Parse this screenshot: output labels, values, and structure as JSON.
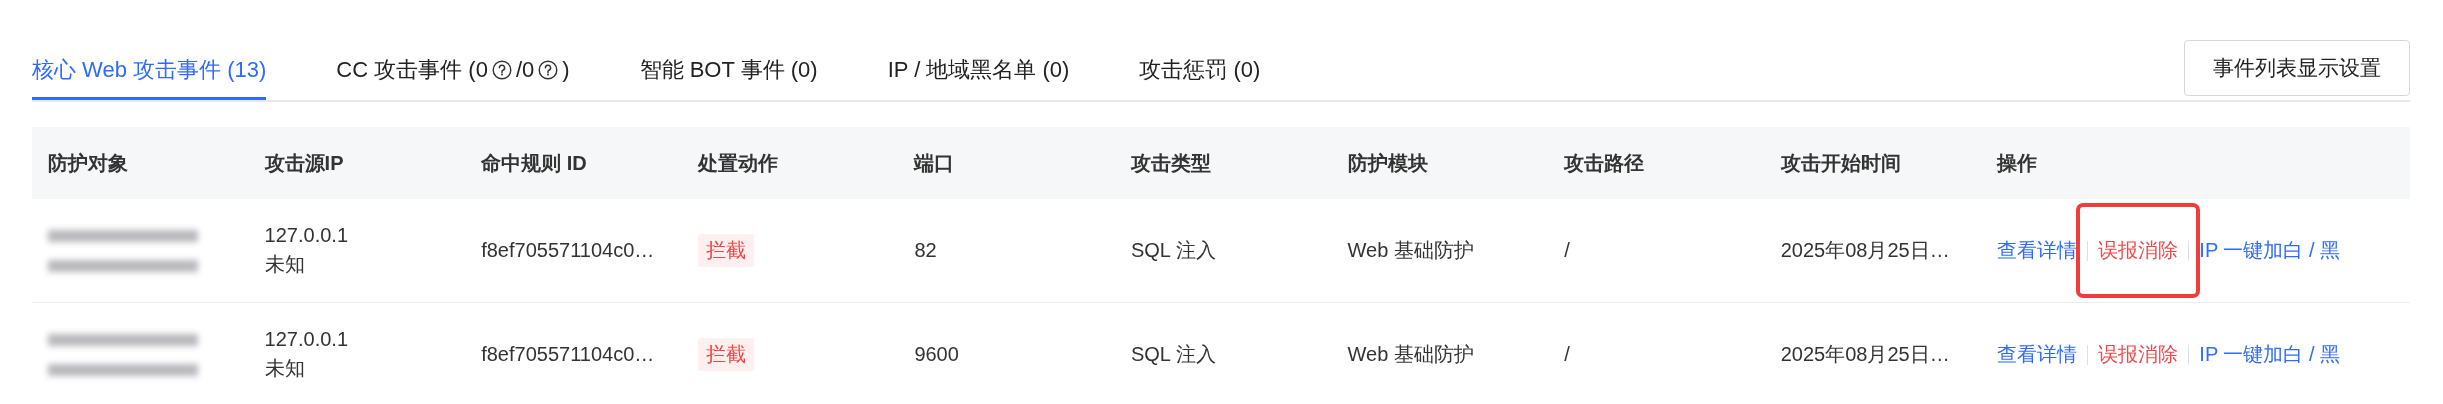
{
  "tabs": [
    {
      "selected": true,
      "segments": [
        {
          "kind": "text",
          "text": "核心 Web 攻击事件 (13)"
        }
      ]
    },
    {
      "selected": false,
      "segments": [
        {
          "kind": "text",
          "text": "CC 攻击事件 (0"
        },
        {
          "kind": "help"
        },
        {
          "kind": "text",
          "text": "/0"
        },
        {
          "kind": "help"
        },
        {
          "kind": "text",
          "text": ")"
        }
      ]
    },
    {
      "selected": false,
      "segments": [
        {
          "kind": "text",
          "text": "智能 BOT 事件 (0)"
        }
      ]
    },
    {
      "selected": false,
      "segments": [
        {
          "kind": "text",
          "text": "IP / 地域黑名单 (0)"
        }
      ]
    },
    {
      "selected": false,
      "segments": [
        {
          "kind": "text",
          "text": "攻击惩罚 (0)"
        }
      ]
    }
  ],
  "settings_button": "事件列表显示设置",
  "table": {
    "columns": [
      "防护对象",
      "攻击源IP",
      "命中规则 ID",
      "处置动作",
      "端口",
      "攻击类型",
      "防护模块",
      "攻击路径",
      "攻击开始时间",
      "操作"
    ],
    "rows": [
      {
        "target": {
          "redacted": true
        },
        "source_ip": "127.0.0.1",
        "source_location": "未知",
        "rule_id": "f8ef705571104c0…",
        "action": {
          "label": "拦截",
          "kind": "block"
        },
        "port": "82",
        "attack_type": "SQL 注入",
        "module": "Web 基础防护",
        "path": "/",
        "start_time": "2025年08月25日…",
        "operations": [
          {
            "label": "查看详情",
            "kind": "link",
            "highlighted": false
          },
          {
            "label": "误报消除",
            "kind": "danger",
            "highlighted": true
          },
          {
            "label": "IP 一键加白 / 黑",
            "kind": "link",
            "highlighted": false
          }
        ]
      },
      {
        "target": {
          "redacted": true
        },
        "source_ip": "127.0.0.1",
        "source_location": "未知",
        "rule_id": "f8ef705571104c0…",
        "action": {
          "label": "拦截",
          "kind": "block"
        },
        "port": "9600",
        "attack_type": "SQL 注入",
        "module": "Web 基础防护",
        "path": "/",
        "start_time": "2025年08月25日…",
        "operations": [
          {
            "label": "查看详情",
            "kind": "link",
            "highlighted": false
          },
          {
            "label": "误报消除",
            "kind": "danger",
            "highlighted": false
          },
          {
            "label": "IP 一键加白 / 黑",
            "kind": "link",
            "highlighted": false
          }
        ]
      }
    ]
  }
}
